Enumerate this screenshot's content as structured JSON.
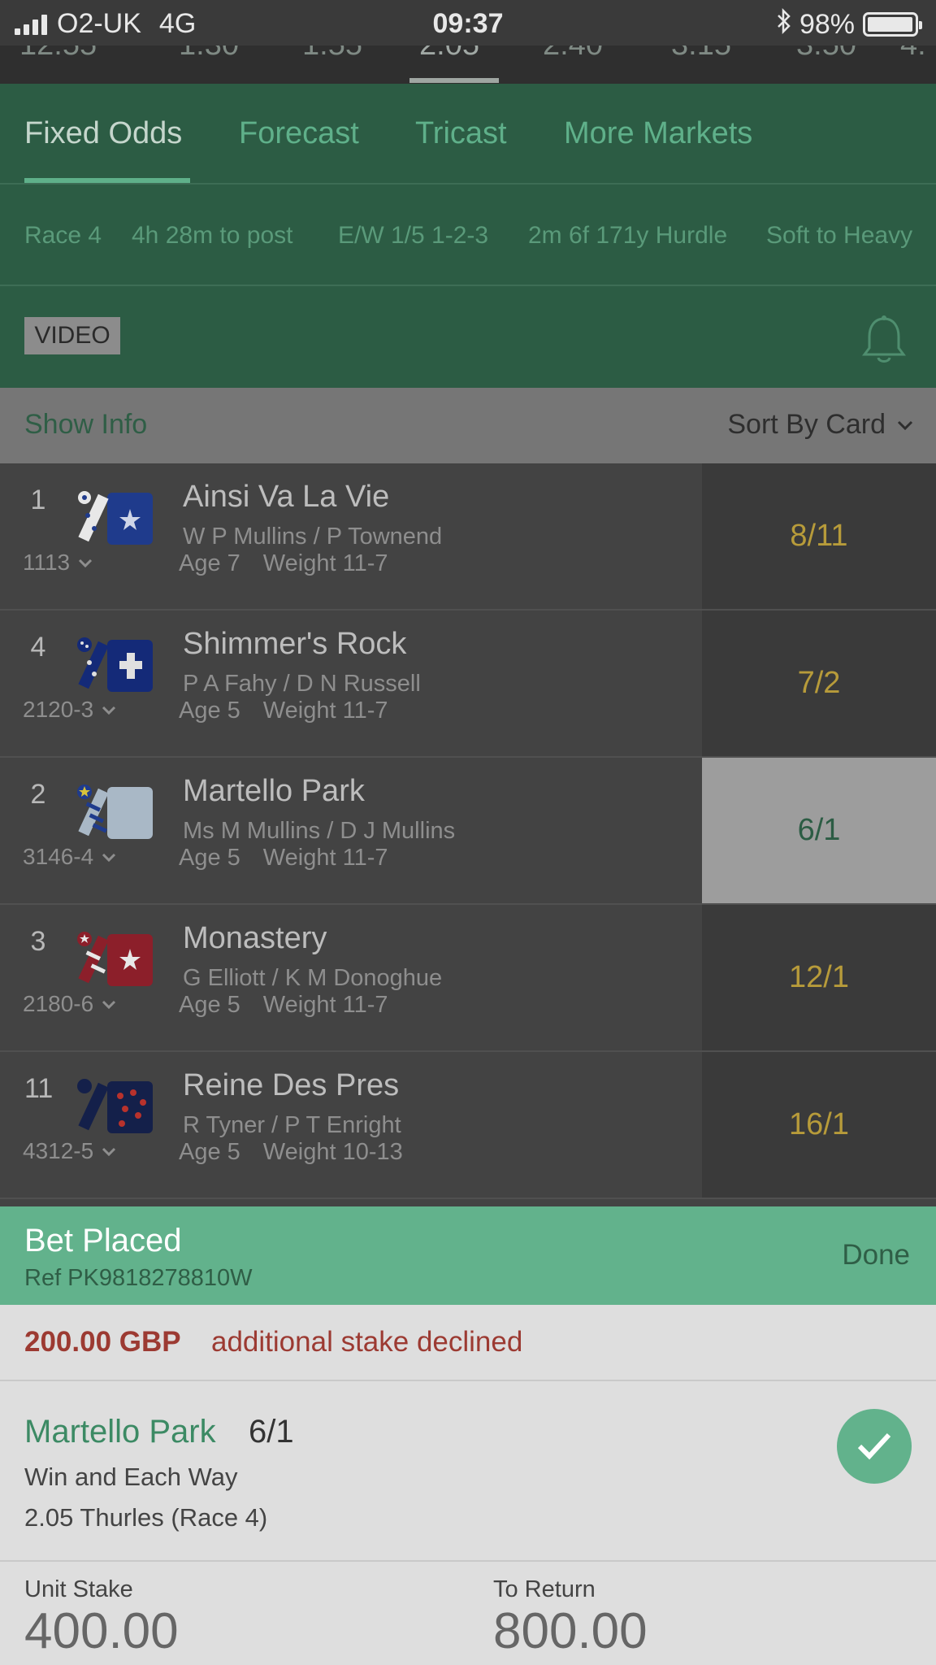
{
  "status_bar": {
    "carrier": "O2-UK",
    "network": "4G",
    "time": "09:37",
    "battery": "98%",
    "battery_level": 0.98
  },
  "race_times": [
    "12:55",
    "1:30",
    "1:55",
    "2:05",
    "2:40",
    "3:15",
    "3:50",
    "4:"
  ],
  "tabs": [
    {
      "label": "Fixed Odds",
      "active": true
    },
    {
      "label": "Forecast",
      "active": false
    },
    {
      "label": "Tricast",
      "active": false
    },
    {
      "label": "More Markets",
      "active": false
    }
  ],
  "race_info": {
    "race": "Race 4",
    "time_to_post": "4h 28m to post",
    "each_way": "E/W 1/5 1-2-3",
    "distance": "2m 6f 171y Hurdle",
    "going": "Soft to Heavy"
  },
  "video_label": "VIDEO",
  "info_bar": {
    "show_info": "Show Info",
    "sort": "Sort By Card"
  },
  "runners": [
    {
      "number": "1",
      "form": "1113",
      "name": "Ainsi Va La Vie",
      "connections": "W P Mullins / P Townend",
      "age": "Age 7",
      "weight": "Weight 11-7",
      "odds": "8/11",
      "selected": false
    },
    {
      "number": "4",
      "form": "2120-3",
      "name": "Shimmer's Rock",
      "connections": "P A Fahy / D N Russell",
      "age": "Age 5",
      "weight": "Weight 11-7",
      "odds": "7/2",
      "selected": false
    },
    {
      "number": "2",
      "form": "3146-4",
      "name": "Martello Park",
      "connections": "Ms M Mullins / D J Mullins",
      "age": "Age 5",
      "weight": "Weight 11-7",
      "odds": "6/1",
      "selected": true
    },
    {
      "number": "3",
      "form": "2180-6",
      "name": "Monastery",
      "connections": "G Elliott / K M Donoghue",
      "age": "Age 5",
      "weight": "Weight 11-7",
      "odds": "12/1",
      "selected": false
    },
    {
      "number": "11",
      "form": "4312-5",
      "name": "Reine Des Pres",
      "connections": "R Tyner / P T Enright",
      "age": "Age 5",
      "weight": "Weight 10-13",
      "odds": "16/1",
      "selected": false
    }
  ],
  "bet_slip": {
    "title": "Bet Placed",
    "reference": "Ref PK9818278810W",
    "done": "Done",
    "declined_amount": "200.00 GBP",
    "declined_message": "additional stake declined",
    "selection_name": "Martello Park",
    "selection_price": "6/1",
    "market": "Win and Each Way",
    "event": "2.05 Thurles (Race 4)",
    "unit_stake_label": "Unit Stake",
    "unit_stake": "400.00",
    "to_return_label": "To Return",
    "to_return": "800.00"
  },
  "colors": {
    "header_green": "#2c5c44",
    "accent_green": "#62b28c",
    "odds_gold": "#b79b3a",
    "declined_red": "#9c3a32"
  }
}
